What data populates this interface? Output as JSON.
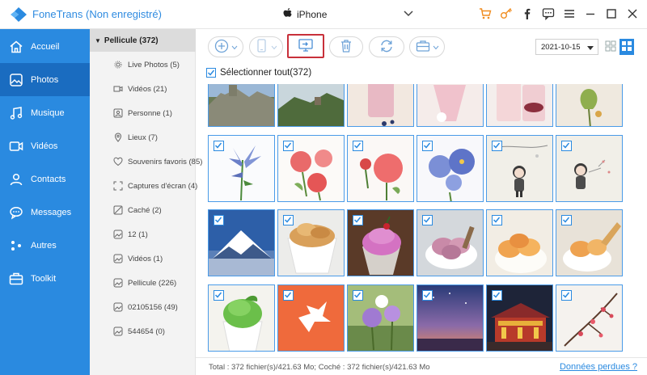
{
  "titlebar": {
    "app_name": "FoneTrans (Non enregistré)",
    "device": "iPhone"
  },
  "nav": {
    "items": [
      {
        "label": "Accueil",
        "icon": "home-icon"
      },
      {
        "label": "Photos",
        "icon": "photo-icon",
        "active": true
      },
      {
        "label": "Musique",
        "icon": "music-icon"
      },
      {
        "label": "Vidéos",
        "icon": "video-icon"
      },
      {
        "label": "Contacts",
        "icon": "contacts-icon"
      },
      {
        "label": "Messages",
        "icon": "messages-icon"
      },
      {
        "label": "Autres",
        "icon": "others-icon"
      },
      {
        "label": "Toolkit",
        "icon": "toolkit-icon"
      }
    ]
  },
  "tree": {
    "root": "Pellicule (372)",
    "items": [
      {
        "label": "Live Photos (5)",
        "icon": "live-photo-icon"
      },
      {
        "label": "Vidéos (21)",
        "icon": "video-icon"
      },
      {
        "label": "Personne (1)",
        "icon": "person-icon"
      },
      {
        "label": "Lieux (7)",
        "icon": "location-icon"
      },
      {
        "label": "Souvenirs favoris (85)",
        "icon": "heart-icon"
      },
      {
        "label": "Captures d'écran (4)",
        "icon": "screenshot-icon"
      },
      {
        "label": "Caché (2)",
        "icon": "hidden-icon"
      },
      {
        "label": "12 (1)",
        "icon": "album-icon"
      },
      {
        "label": "Vidéos (1)",
        "icon": "album-icon"
      },
      {
        "label": "Pellicule (226)",
        "icon": "album-icon"
      },
      {
        "label": "02105156 (49)",
        "icon": "album-icon"
      },
      {
        "label": "544654 (0)",
        "icon": "album-icon"
      }
    ]
  },
  "toolbar": {
    "date": "2021-10-15"
  },
  "content": {
    "select_all_label": "Sélectionner tout(372)"
  },
  "status": {
    "text": "Total : 372 fichier(s)/421.63 Mo; Coché : 372 fichier(s)/421.63 Mo",
    "lost_data_link": "Données perdues ?"
  },
  "colors": {
    "accent": "#2a8ae0",
    "nav_active": "#1a6cc0",
    "highlight_border": "#c8303a",
    "cart_icon": "#f08c1e"
  }
}
